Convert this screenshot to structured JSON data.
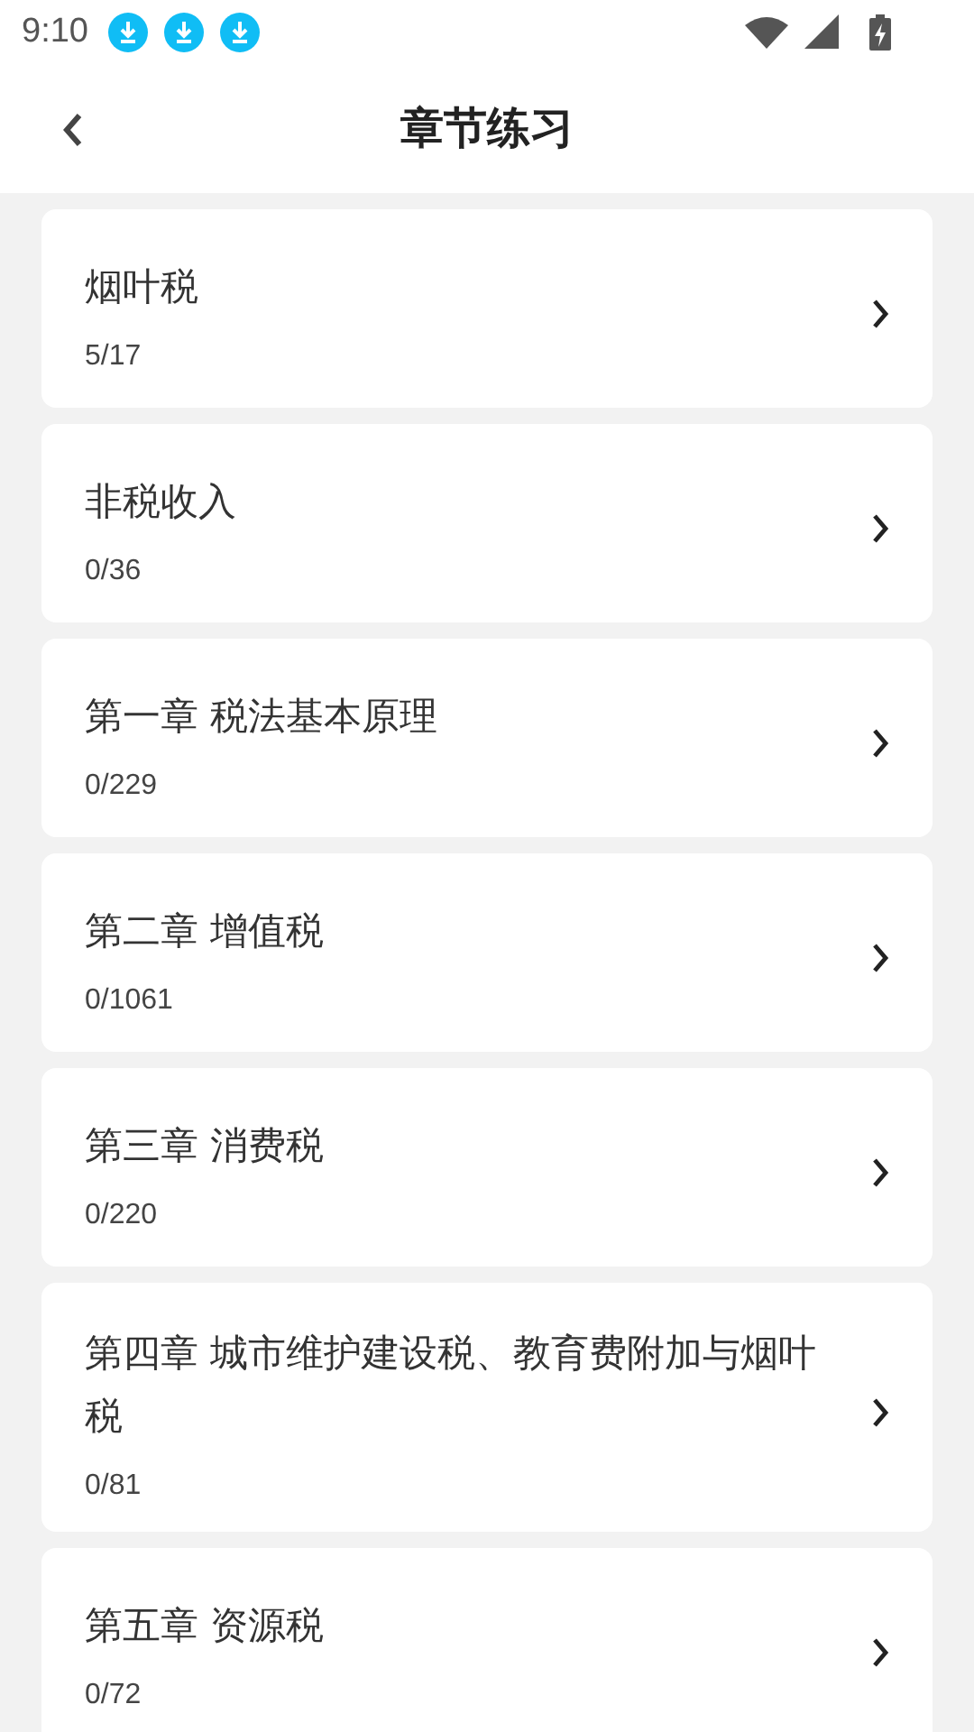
{
  "status_bar": {
    "time": "9:10",
    "notifications": [
      {
        "kind": "download"
      },
      {
        "kind": "download"
      },
      {
        "kind": "download"
      }
    ]
  },
  "header": {
    "title": "章节练习"
  },
  "chapters": [
    {
      "title": "烟叶税",
      "progress": "5/17"
    },
    {
      "title": "非税收入",
      "progress": "0/36"
    },
    {
      "title": "第一章 税法基本原理",
      "progress": "0/229"
    },
    {
      "title": "第二章 增值税",
      "progress": "0/1061"
    },
    {
      "title": "第三章 消费税",
      "progress": "0/220"
    },
    {
      "title": "第四章 城市维护建设税、教育费附加与烟叶税",
      "progress": "0/81"
    },
    {
      "title": "第五章 资源税",
      "progress": "0/72"
    }
  ]
}
